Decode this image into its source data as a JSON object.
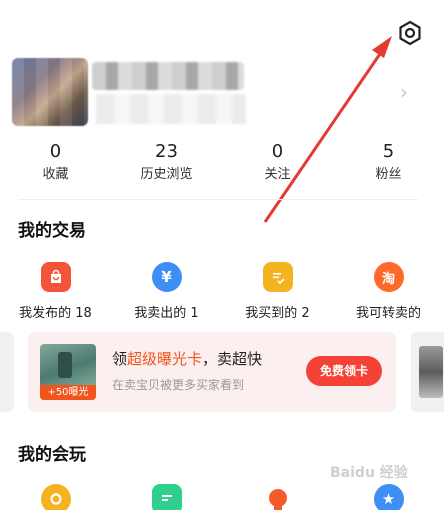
{
  "header": {
    "settings_icon": "gear-icon"
  },
  "profile": {
    "avatar": "blurred-avatar",
    "name": ""
  },
  "stats": [
    {
      "value": "0",
      "label": "收藏"
    },
    {
      "value": "23",
      "label": "历史浏览"
    },
    {
      "value": "0",
      "label": "关注"
    },
    {
      "value": "5",
      "label": "粉丝"
    }
  ],
  "trade": {
    "title": "我的交易",
    "items": [
      {
        "label": "我发布的 18",
        "icon": "bag-icon",
        "color": "#f4553a"
      },
      {
        "label": "我卖出的 1",
        "icon": "yen-icon",
        "color": "#3d8ff5"
      },
      {
        "label": "我买到的 2",
        "icon": "check-doc-icon",
        "color": "#f5b31f"
      },
      {
        "label": "我可转卖的",
        "icon": "tao-icon",
        "color": "#ff6a2a"
      }
    ]
  },
  "promo": {
    "title_prefix": "领",
    "title_highlight": "超级曝光卡",
    "title_suffix": "，卖超快",
    "subtitle": "在卖宝贝被更多买家看到",
    "badge": "+50曝光",
    "button": "免费领卡"
  },
  "play": {
    "title": "我的会玩",
    "items": [
      {
        "icon": "circle-icon",
        "color": "#f5b31f"
      },
      {
        "icon": "note-icon",
        "color": "#2fcf8e"
      },
      {
        "icon": "bulb-icon",
        "color": "#f45a2a"
      },
      {
        "icon": "star-icon",
        "color": "#3d8ff5"
      }
    ]
  },
  "watermark": "Baidu 经验"
}
